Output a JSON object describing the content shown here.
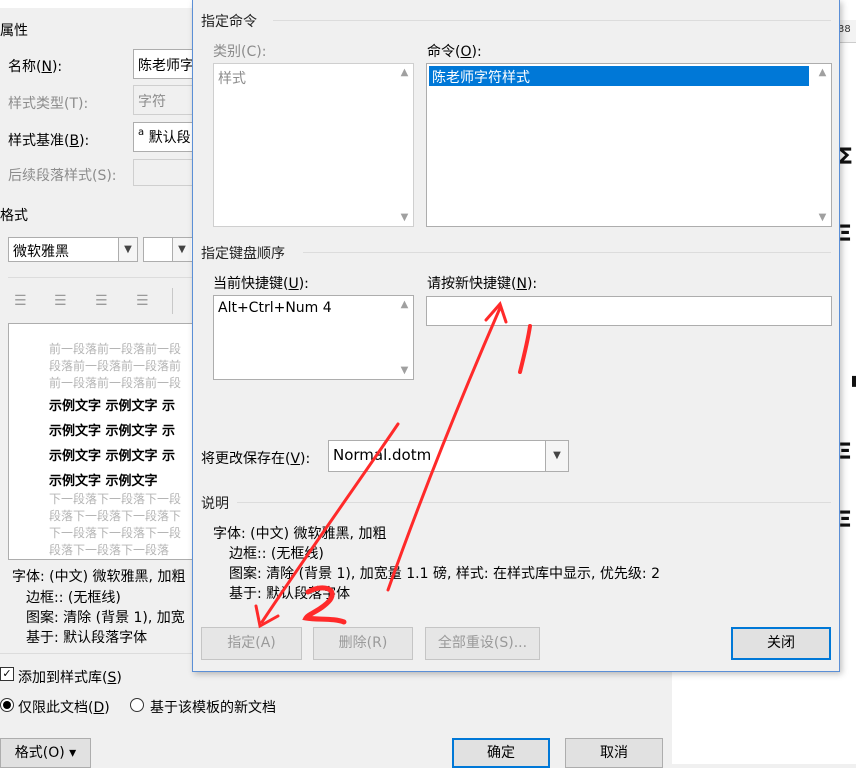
{
  "background_dialog": {
    "section_properties": "属性",
    "name_label": "名称(N):",
    "name_value": "陈老师字",
    "style_type_label": "样式类型(T):",
    "style_type_value": "字符",
    "style_based_label": "样式基准(B):",
    "style_based_value": "默认段",
    "style_based_icon": "a",
    "following_label": "后续段落样式(S):",
    "section_format": "格式",
    "font_value": "微软雅黑",
    "preview_lines": {
      "prev": [
        "前一段落前一段落前一段",
        "段落前一段落前一段落前",
        "前一段落前一段落前一段"
      ],
      "sample": [
        "示例文字  示例文字  示",
        "示例文字  示例文字  示",
        "示例文字  示例文字  示",
        "示例文字  示例文字"
      ],
      "next": [
        "下一段落下一段落下一段",
        "段落下一段落下一段落下",
        "下一段落下一段落下一段",
        "段落下一段落下一段落"
      ]
    },
    "description_lines": [
      "字体: (中文) 微软雅黑, 加粗",
      "边框:: (无框线)",
      "图案: 清除 (背景 1), 加宽",
      "基于: 默认段落字体"
    ],
    "add_to_gallery_label": "添加到样式库(S)",
    "only_this_doc_label": "仅限此文档(D)",
    "new_docs_template_label": "基于该模板的新文档",
    "format_button": "格式(O) ▾",
    "ok_button": "确定",
    "cancel_button": "取消"
  },
  "dialog": {
    "group_specify_command": "指定命令",
    "category_label": "类别(C):",
    "category_item": "样式",
    "commands_label": "命令(O):",
    "commands_selected": "陈老师字符样式",
    "group_keyboard": "指定键盘顺序",
    "current_keys_label": "当前快捷键(U):",
    "current_keys_item": "Alt+Ctrl+Num 4",
    "new_key_label": "请按新快捷键(N):",
    "new_key_value": "",
    "save_in_label": "将更改保存在(V):",
    "save_in_value": "Normal.dotm",
    "group_description": "说明",
    "desc_lines": [
      "字体: (中文) 微软雅黑, 加粗",
      "边框:: (无框线)",
      "图案: 清除 (背景 1), 加宽量 1.1 磅, 样式: 在样式库中显示, 优先级: 2",
      "基于: 默认段落字体"
    ],
    "assign_button": "指定(A)",
    "delete_button": "删除(R)",
    "reset_all_button": "全部重设(S)...",
    "close_button": "关闭"
  },
  "annotations": {
    "mark_1": "1",
    "mark_2": "2",
    "color": "#ff2a2a"
  },
  "document_bg": {
    "corner_text": "38"
  }
}
